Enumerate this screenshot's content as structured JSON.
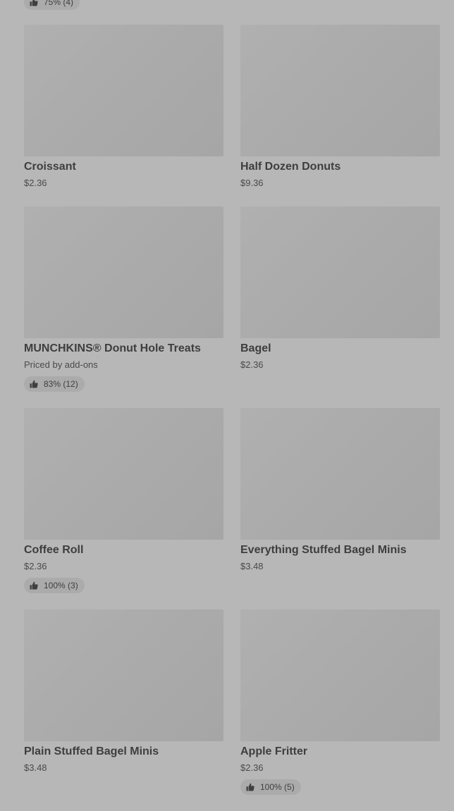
{
  "top_partial_rating": {
    "text": "75% (4)"
  },
  "icons": {
    "rating": "thumbs-up-icon"
  },
  "items": [
    {
      "name": "Croissant",
      "price": "$2.36"
    },
    {
      "name": "Half Dozen Donuts",
      "price": "$9.36"
    },
    {
      "name": "MUNCHKINS® Donut Hole Treats",
      "price": "Priced by add-ons",
      "rating": "83% (12)"
    },
    {
      "name": "Bagel",
      "price": "$2.36"
    },
    {
      "name": "Coffee Roll",
      "price": "$2.36",
      "rating": "100% (3)"
    },
    {
      "name": "Everything Stuffed Bagel Minis",
      "price": "$3.48"
    },
    {
      "name": "Plain Stuffed Bagel Minis",
      "price": "$3.48"
    },
    {
      "name": "Apple Fritter",
      "price": "$2.36",
      "rating": "100% (5)"
    }
  ]
}
